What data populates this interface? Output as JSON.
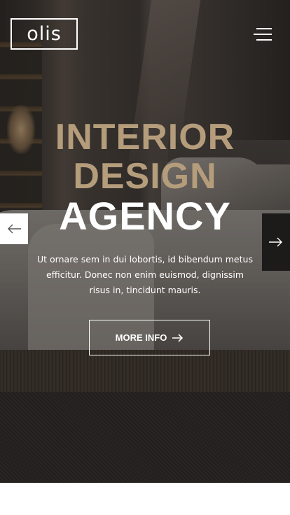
{
  "header": {
    "logo_text": "olis",
    "menu_icon": "hamburger-menu-icon"
  },
  "hero": {
    "headline_line1": "INTERIOR",
    "headline_line2": "DESIGN",
    "headline_line3": "AGENCY",
    "description": "Ut ornare sem in dui lobortis, id bibendum metus efficitur. Donec non enim euismod, dignissim risus in, tincidunt mauris.",
    "button_label": "MORE INFO",
    "button_icon": "arrow-right-icon",
    "accent_color": "#b59d7c"
  },
  "slider": {
    "prev_icon": "arrow-left-icon",
    "next_icon": "arrow-right-icon"
  }
}
